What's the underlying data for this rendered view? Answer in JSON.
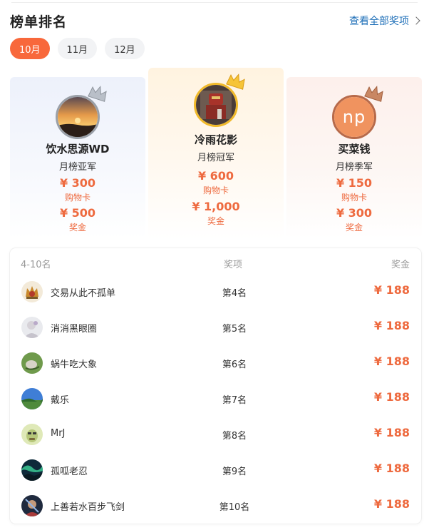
{
  "header": {
    "title": "榜单排名",
    "view_all": "查看全部奖项"
  },
  "tabs": [
    {
      "label": "10月",
      "active": true
    },
    {
      "label": "11月",
      "active": false
    },
    {
      "label": "12月",
      "active": false
    }
  ],
  "podium": {
    "first": {
      "name": "冷雨花影",
      "rank": "月榜冠军",
      "card_amount": "¥ 600",
      "card_label": "购物卡",
      "bonus_amount": "¥ 1,000",
      "bonus_label": "奖金"
    },
    "second": {
      "name": "饮水思源WD",
      "rank": "月榜亚军",
      "card_amount": "¥ 300",
      "card_label": "购物卡",
      "bonus_amount": "¥ 500",
      "bonus_label": "奖金"
    },
    "third": {
      "name": "买菜钱",
      "avatar_text": "np",
      "rank": "月榜季军",
      "card_amount": "¥ 150",
      "card_label": "购物卡",
      "bonus_amount": "¥ 300",
      "bonus_label": "奖金"
    }
  },
  "list": {
    "headers": {
      "rank": "4-10名",
      "award": "奖项",
      "prize": "奖金"
    },
    "rows": [
      {
        "name": "交易从此不孤单",
        "place": "第4名",
        "prize": "¥ 188"
      },
      {
        "name": "消消黑眼圈",
        "place": "第5名",
        "prize": "¥ 188"
      },
      {
        "name": "蜗牛吃大象",
        "place": "第6名",
        "prize": "¥ 188"
      },
      {
        "name": "戴乐",
        "place": "第7名",
        "prize": "¥ 188"
      },
      {
        "name": "MrJ",
        "place": "第8名",
        "prize": "¥ 188"
      },
      {
        "name": "孤呱老忍",
        "place": "第9名",
        "prize": "¥ 188"
      },
      {
        "name": "上善若水百步飞剑",
        "place": "第10名",
        "prize": "¥ 188"
      }
    ]
  },
  "colors": {
    "accent": "#f8683b",
    "prize": "#ee6a3f",
    "link": "#1e6fb8",
    "gold": "#f0b92a",
    "silver": "#9aa0a8",
    "bronze": "#b76a4a"
  }
}
